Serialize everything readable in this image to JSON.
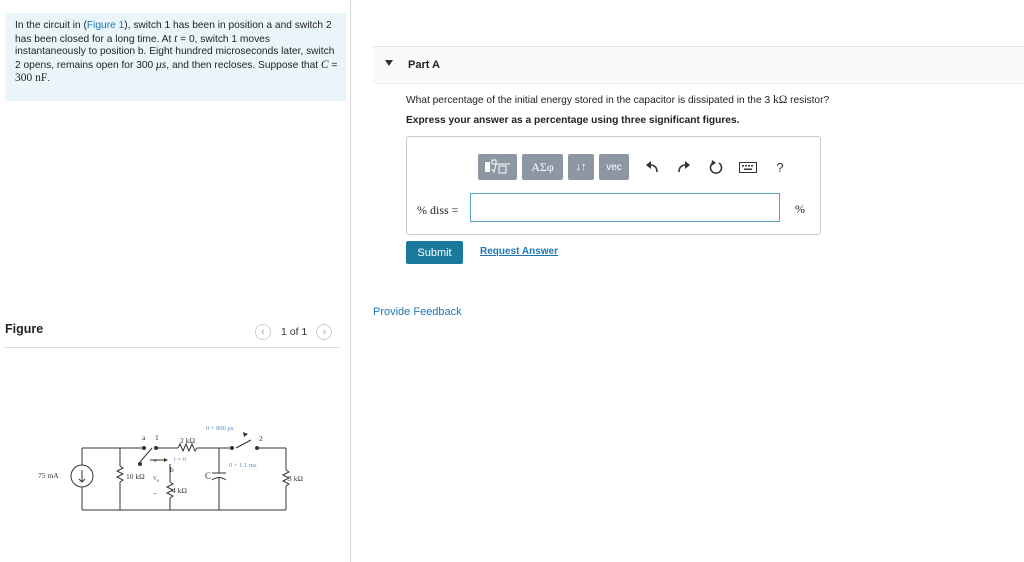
{
  "problem": {
    "s1": "In the circuit in (",
    "figure_link": "Figure 1",
    "s2": "), switch 1 has been in position a and switch 2 has been closed for a long time. At ",
    "t_var": "t",
    "s3": " = 0, switch 1 moves instantaneously to position b. Eight hundred microseconds later, switch 2 opens, remains open for 300 ",
    "mu_unit": "μs",
    "s4": ", and then recloses. Suppose that ",
    "c_var": "C",
    "s5": " = ",
    "c_value": "300 nF",
    "s6": "."
  },
  "figure": {
    "title": "Figure",
    "pager_text": "1 of 1",
    "prev_icon": "chevron-left-icon",
    "next_icon": "chevron-right-icon"
  },
  "circuit": {
    "source": "75 mA",
    "r1": "10 kΩ",
    "v_label": "v",
    "v_sub": "o",
    "r2": "2 kΩ",
    "r3": "4 kΩ",
    "r4": "3 kΩ",
    "cap": "C",
    "switch1_time": "t = 0",
    "switch2_time1": "0 + 800 μs",
    "switch2_time2": "0 + 1.1 ms",
    "node_a": "a",
    "node_b": "b",
    "sw1": "1",
    "sw2": "2",
    "plus": "+",
    "minus": "−"
  },
  "part": {
    "title": "Part A",
    "question_pre": "What percentage of the initial energy stored in the capacitor is dissipated in the 3 ",
    "question_unit": "kΩ",
    "question_post": " resistor?",
    "instruction": "Express your answer as a percentage using three significant figures."
  },
  "toolbar": {
    "greek_label": "ΑΣφ",
    "arrows_label": "↓↑",
    "vec_label": "vec",
    "help_label": "?",
    "icons": [
      "templates-icon",
      "greek-icon",
      "subscript-icon",
      "vector-icon",
      "undo-icon",
      "redo-icon",
      "reset-icon",
      "keyboard-icon",
      "help-icon"
    ]
  },
  "answer": {
    "label": "% diss =",
    "value": "",
    "unit": "%"
  },
  "actions": {
    "submit": "Submit",
    "request_answer": "Request Answer",
    "provide_feedback": "Provide Feedback"
  },
  "colors": {
    "link": "#1d76b3",
    "submit_bg": "#1a7a9e",
    "problem_bg": "#eaf5fa",
    "toolbar_bg": "#8d97a3",
    "input_border": "#55a2bf"
  }
}
